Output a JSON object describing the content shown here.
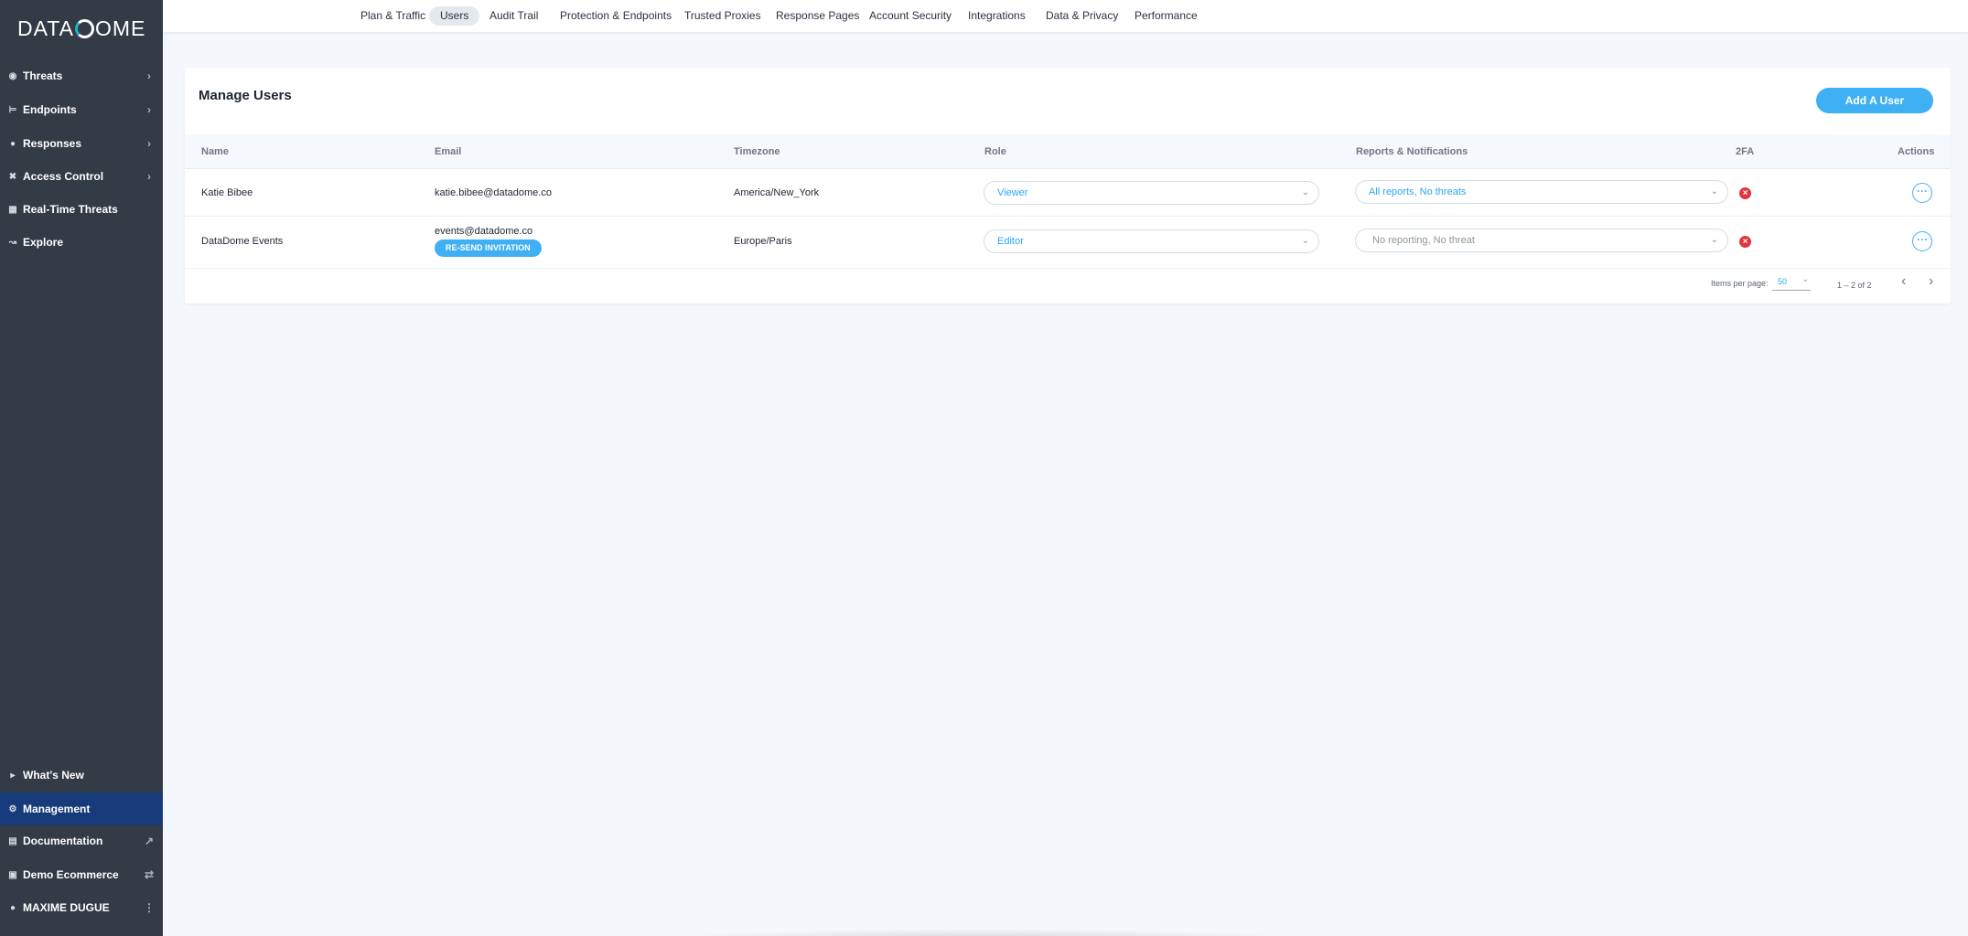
{
  "brand": {
    "logo_left": "DATA",
    "logo_right": "OME",
    "accent": "#3fb0f3",
    "sidebar_bg": "#333b47",
    "active_bg": "#163a7a"
  },
  "sidebar": {
    "items": [
      {
        "label": "Threats",
        "icon": "threats-icon"
      },
      {
        "label": "Endpoints",
        "icon": "endpoints-icon"
      },
      {
        "label": "Responses",
        "icon": "responses-icon"
      },
      {
        "label": "Access Control",
        "icon": "access-control-icon"
      },
      {
        "label": "Real-Time Threats",
        "icon": "realtime-icon"
      },
      {
        "label": "Explore",
        "icon": "explore-icon"
      }
    ],
    "bottom_items": [
      {
        "label": "What's New",
        "icon": "megaphone-icon"
      },
      {
        "label": "Management",
        "icon": "gear-icon",
        "active": true
      },
      {
        "label": "Documentation",
        "icon": "document-icon",
        "trailing_icon": "external-link-icon"
      },
      {
        "label": "Demo Ecommerce",
        "icon": "building-icon",
        "trailing_icon": "switch-icon"
      },
      {
        "label": "MAXIME DUGUE",
        "icon": "user-icon",
        "trailing_icon": "kebab-icon"
      }
    ]
  },
  "tabs": [
    {
      "label": "Plan & Traffic"
    },
    {
      "label": "Users",
      "active": true
    },
    {
      "label": "Audit Trail"
    },
    {
      "label": "Protection & Endpoints"
    },
    {
      "label": "Trusted Proxies"
    },
    {
      "label": "Response Pages"
    },
    {
      "label": "Account Security"
    },
    {
      "label": "Integrations"
    },
    {
      "label": "Data & Privacy"
    },
    {
      "label": "Performance"
    }
  ],
  "main": {
    "title": "Manage Users",
    "add_button": "Add A User",
    "columns": {
      "name": "Name",
      "email": "Email",
      "timezone": "Timezone",
      "role": "Role",
      "reports": "Reports & Notifications",
      "twofa": "2FA",
      "actions": "Actions"
    },
    "rows": [
      {
        "name": "Katie Bibee",
        "email": "katie.bibee@datadome.co",
        "timezone": "America/New_York",
        "role": "Viewer",
        "reports": "All reports, No threats",
        "twofa": "disabled",
        "resend": ""
      },
      {
        "name": "DataDome Events",
        "email": "events@datadome.co",
        "timezone": "Europe/Paris",
        "role": "Editor",
        "reports": "No reporting, No threat",
        "twofa": "disabled",
        "resend": "RE-SEND INVITATION"
      }
    ],
    "pagination": {
      "items_per_page_label": "Items per page:",
      "items_per_page": "50",
      "range": "1 – 2 of 2"
    }
  }
}
